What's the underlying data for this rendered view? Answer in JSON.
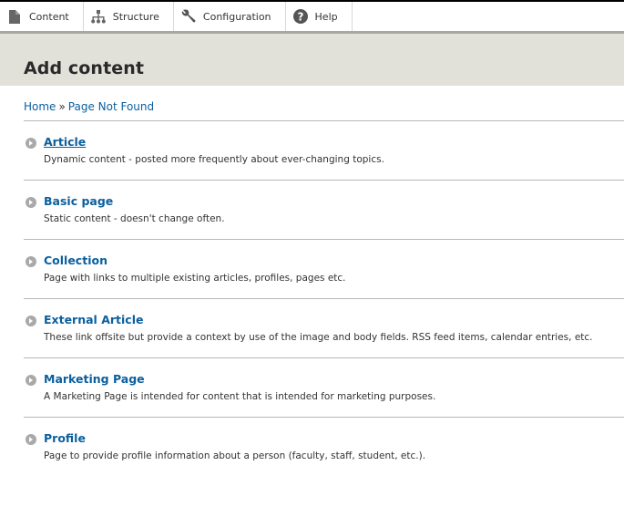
{
  "toolbar": {
    "items": [
      {
        "label": "Content",
        "icon": "document-icon"
      },
      {
        "label": "Structure",
        "icon": "hierarchy-icon"
      },
      {
        "label": "Configuration",
        "icon": "wrench-icon"
      },
      {
        "label": "Help",
        "icon": "help-icon"
      }
    ]
  },
  "header": {
    "title": "Add content"
  },
  "breadcrumb": {
    "home": "Home",
    "separator": "»",
    "current": "Page Not Found"
  },
  "content_types": [
    {
      "title": "Article",
      "description": "Dynamic content - posted more frequently about ever-changing topics."
    },
    {
      "title": "Basic page",
      "description": "Static content - doesn't change often."
    },
    {
      "title": "Collection",
      "description": "Page with links to multiple existing articles, profiles, pages etc."
    },
    {
      "title": "External Article",
      "description": "These link offsite but provide a context by use of the image and body fields. RSS feed items, calendar entries, etc."
    },
    {
      "title": "Marketing Page",
      "description": "A Marketing Page is intended for content that is intended for marketing purposes."
    },
    {
      "title": "Profile",
      "description": "Page to provide profile information about a person (faculty, staff, student, etc.)."
    }
  ]
}
